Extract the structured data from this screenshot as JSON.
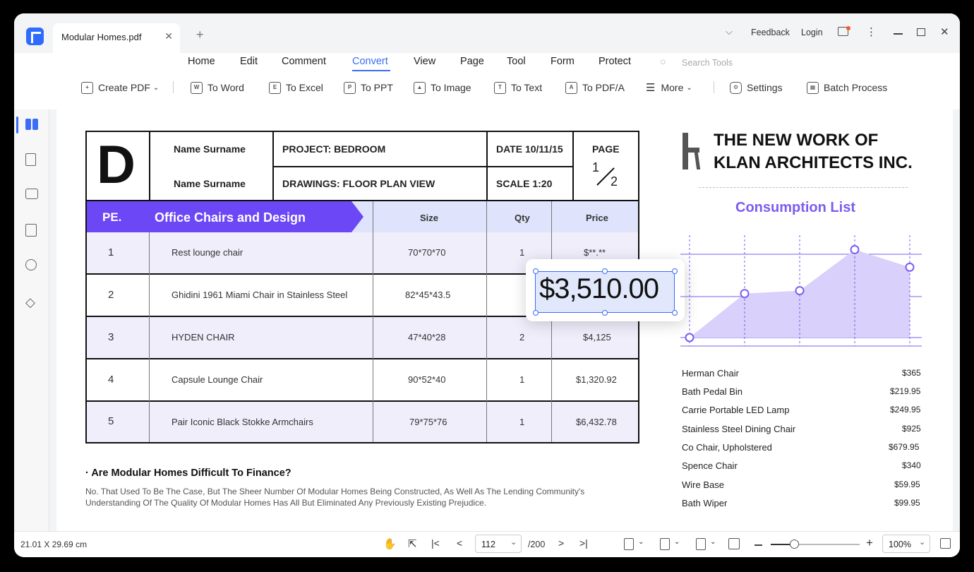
{
  "tab": {
    "title": "Modular Homes.pdf",
    "close": "✕",
    "new": "+"
  },
  "titlebar": {
    "feedback": "Feedback",
    "login": "Login"
  },
  "menu": [
    "Home",
    "Edit",
    "Comment",
    "Convert",
    "View",
    "Page",
    "Tool",
    "Form",
    "Protect"
  ],
  "search_tools": "Search Tools",
  "toolbar": {
    "create_pdf": "Create PDF",
    "to_word": "To Word",
    "to_excel": "To Excel",
    "to_ppt": "To PPT",
    "to_image": "To Image",
    "to_text": "To Text",
    "to_pdfa": "To PDF/A",
    "more": "More",
    "settings": "Settings",
    "batch": "Batch Process"
  },
  "doc": {
    "letter": "D",
    "name1": "Name Surname",
    "name2": "Name Surname",
    "project": "PROJECT: BEDROOM",
    "drawings": "DRAWINGS: FLOOR PLAN VIEW",
    "date": "DATE 10/11/15",
    "scale": "SCALE 1:20",
    "page_label": "PAGE",
    "page_num": "1",
    "page_total": "2",
    "hdr_pe": "PE.",
    "hdr_title": "Office Chairs and Design",
    "hdr_size": "Size",
    "hdr_qty": "Qty",
    "hdr_price": "Price",
    "rows": [
      {
        "no": "1",
        "name": "Rest lounge chair",
        "size": "70*70*70",
        "qty": "1",
        "price": "$**.**"
      },
      {
        "no": "2",
        "name": "Ghidini 1961 Miami Chair in Stainless Steel",
        "size": "82*45*43.5",
        "qty": "",
        "price": ""
      },
      {
        "no": "3",
        "name": "HYDEN CHAIR",
        "size": "47*40*28",
        "qty": "2",
        "price": "$4,125"
      },
      {
        "no": "4",
        "name": "Capsule Lounge Chair",
        "size": "90*52*40",
        "qty": "1",
        "price": "$1,320.92"
      },
      {
        "no": "5",
        "name": "Pair Iconic Black Stokke Armchairs",
        "size": "79*75*76",
        "qty": "1",
        "price": "$6,432.78"
      }
    ],
    "edit_value": "$3,510.00",
    "question": "· Are Modular Homes Difficult To Finance?",
    "answer_line1": "No. That Used To Be The Case, But The Sheer Number Of Modular Homes Being Constructed, As Well As The Lending Community's",
    "answer_line2": "Understanding Of The Quality Of Modular Homes Has All But Eliminated Any Previously Existing Prejudice."
  },
  "panel": {
    "heading1": "THE NEW WORK OF",
    "heading2": "KLAN ARCHITECTS INC.",
    "list_title": "Consumption List",
    "items": [
      {
        "name": "Herman Chair",
        "price": "$365"
      },
      {
        "name": "Bath Pedal Bin",
        "price": "$219.95"
      },
      {
        "name": "Carrie Portable LED Lamp",
        "price": "$249.95"
      },
      {
        "name": "Stainless Steel Dining Chair",
        "price": "$925"
      },
      {
        "name": "Co Chair, Upholstered",
        "price": "$679.95"
      },
      {
        "name": "Spence Chair",
        "price": "$340"
      },
      {
        "name": "Wire Base",
        "price": "$59.95"
      },
      {
        "name": "Bath Wiper",
        "price": "$99.95"
      }
    ]
  },
  "chart_data": {
    "type": "area",
    "x": [
      1,
      2,
      3,
      4,
      5
    ],
    "values": [
      0,
      1.5,
      1.6,
      3.0,
      2.4
    ],
    "ylim": [
      0,
      3.3
    ],
    "grid": true,
    "color": "#7b5cf0"
  },
  "status": {
    "dimensions": "21.01 X 29.69 cm",
    "page": "112",
    "total": "/200",
    "zoom": "100%"
  },
  "colors": {
    "accent": "#3a6cf6",
    "purple": "#6c47f5",
    "row_tint": "#f0eefb"
  }
}
